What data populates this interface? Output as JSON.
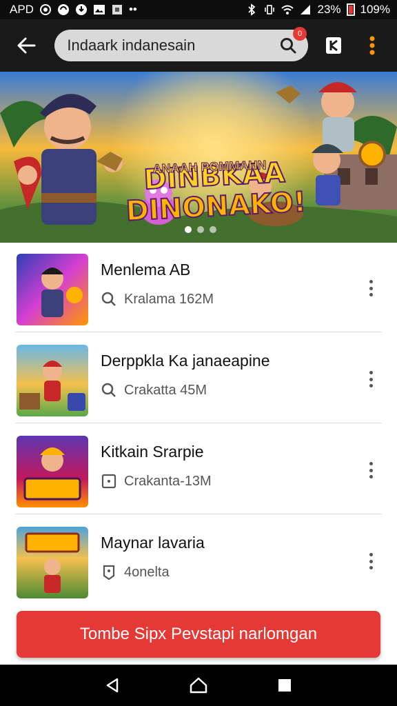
{
  "status_bar": {
    "carrier": "APD",
    "battery_text": "23%",
    "battery_percent": "109%"
  },
  "app_bar": {
    "search_value": "Indaark indanesain",
    "search_badge": "0"
  },
  "banner": {
    "title_line1": "DINBKAA",
    "title_line2": "DINONAKO!",
    "subtitle": "ANAAH POMMAHN",
    "carousel_active": 0,
    "carousel_count": 3
  },
  "list": {
    "items": [
      {
        "title": "Menlema AB",
        "meta": "Kralama 162M",
        "meta_icon": "search-icon",
        "thumb_bg": "#3b4fc4"
      },
      {
        "title": "Derppkla Ka janaeapine",
        "meta": "Crakatta 45M",
        "meta_icon": "search-icon",
        "thumb_bg": "#5aa84a"
      },
      {
        "title": "Kitkain Srarpie",
        "meta": "Crakanta-13M",
        "meta_icon": "box-icon",
        "thumb_bg": "#6a3fb5"
      },
      {
        "title": "Maynar lavaria",
        "meta": "4onelta",
        "meta_icon": "tag-icon",
        "thumb_bg": "#4fa3d9"
      }
    ]
  },
  "cta": {
    "label": "Tombe Sipx Pevstapi narlomgan"
  },
  "colors": {
    "accent": "#e53935",
    "app_bar": "#1a1a1a",
    "search_bg": "#d9d9d9"
  }
}
